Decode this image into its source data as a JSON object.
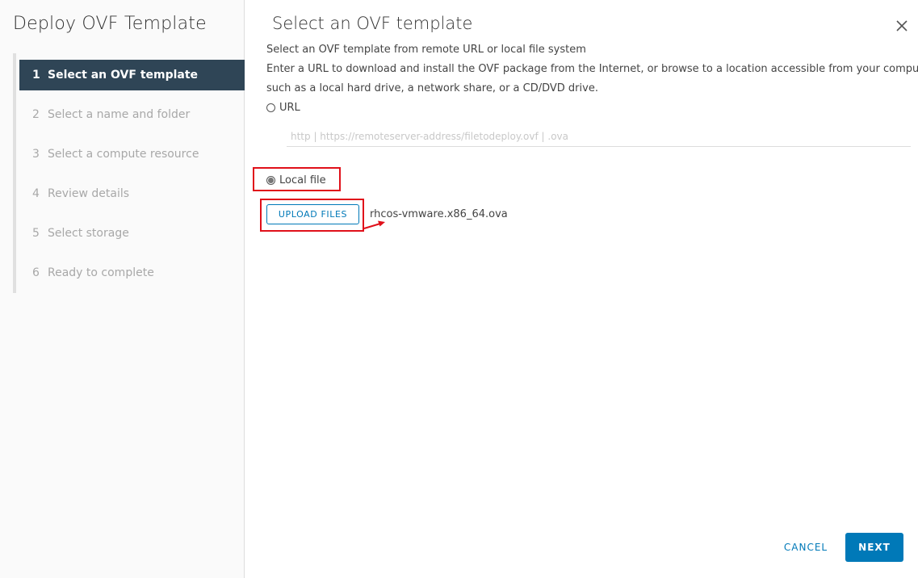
{
  "sidebar": {
    "title": "Deploy OVF Template",
    "steps": [
      {
        "num": "1",
        "label": "Select an OVF template"
      },
      {
        "num": "2",
        "label": "Select a name and folder"
      },
      {
        "num": "3",
        "label": "Select a compute resource"
      },
      {
        "num": "4",
        "label": "Review details"
      },
      {
        "num": "5",
        "label": "Select storage"
      },
      {
        "num": "6",
        "label": "Ready to complete"
      }
    ]
  },
  "main": {
    "title": "Select an OVF template",
    "subtitle": "Select an OVF template from remote URL or local file system",
    "description_line1": "Enter a URL to download and install the OVF package from the Internet, or browse to a location accessible from your computer,",
    "description_line2": "such as a local hard drive, a network share, or a CD/DVD drive.",
    "url_option_label": "URL",
    "url_placeholder": "http | https://remoteserver-address/filetodeploy.ovf | .ova",
    "local_file_option_label": "Local file",
    "upload_button_label": "UPLOAD FILES",
    "selected_file": "rhcos-vmware.x86_64.ova"
  },
  "footer": {
    "cancel_label": "CANCEL",
    "next_label": "NEXT"
  },
  "colors": {
    "accent": "#0079b8",
    "active_step_bg": "#2f4556",
    "annotation": "#e0101a"
  },
  "icons": {
    "close": "close-icon",
    "annotation_arrow": "arrow-icon"
  }
}
